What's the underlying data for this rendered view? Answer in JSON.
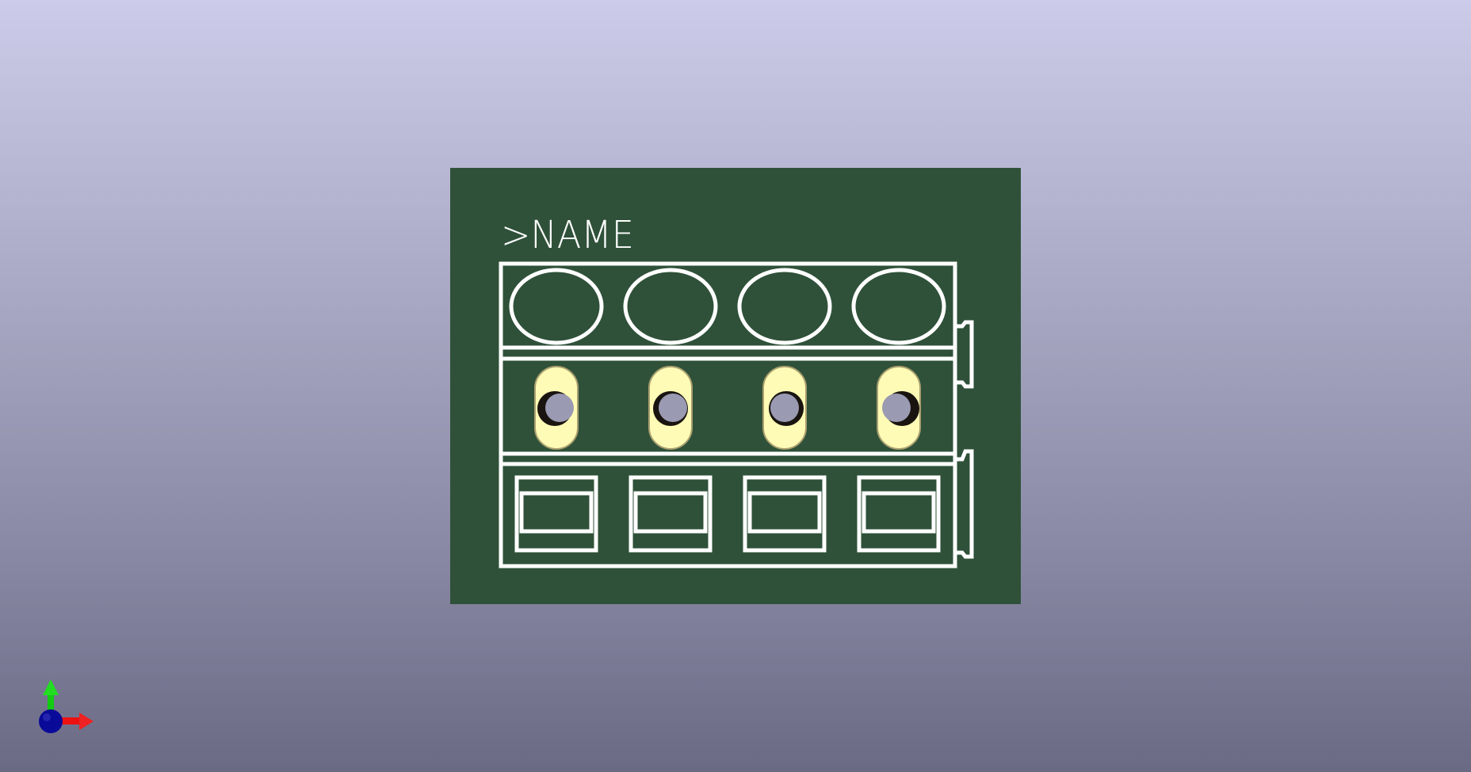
{
  "viewer": {
    "background_top": "#ccccea",
    "background_bottom": "#6a6a84"
  },
  "board": {
    "silkscreen_label": ">NAME",
    "board_color": "#2f5139",
    "silkscreen_color": "#ffffff",
    "pad_color": "#fdfbb5",
    "drill_color": "#9a9ab3",
    "pin_count": 4
  },
  "axis_gizmo": {
    "x_color": "#ee1111",
    "y_color": "#11cc11",
    "z_color": "#0a0a99"
  }
}
